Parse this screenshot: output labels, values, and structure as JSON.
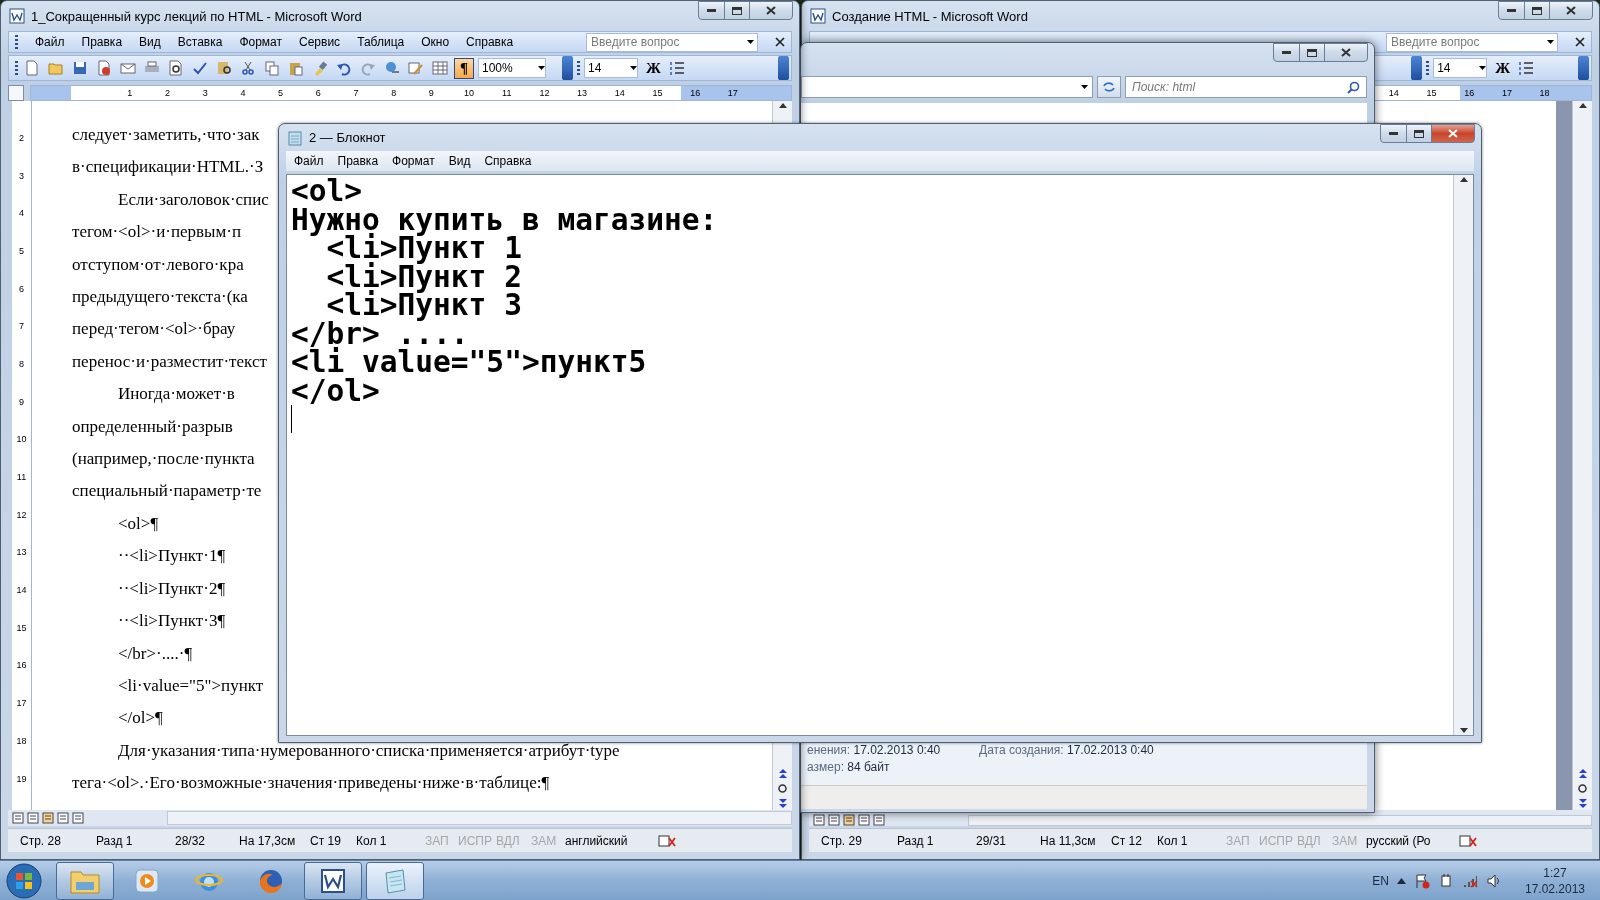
{
  "left_word": {
    "title": "1_Сокращенный курс лекций по HTML - Microsoft Word",
    "menu": [
      "Файл",
      "Правка",
      "Вид",
      "Вставка",
      "Формат",
      "Сервис",
      "Таблица",
      "Окно",
      "Справка"
    ],
    "question_placeholder": "Введите вопрос",
    "pilcrow_button": {
      "label": "¶",
      "selected": true
    },
    "zoom": "100%",
    "font_size": "14",
    "bold_button": "Ж",
    "ruler": [
      "1",
      "2",
      "3",
      "4",
      "5",
      "6",
      "7",
      "8",
      "9",
      "10",
      "11",
      "12",
      "13",
      "14",
      "15",
      "16",
      "17"
    ],
    "vertical_ruler": [
      "2",
      "3",
      "4",
      "5",
      "6",
      "7",
      "8",
      "9",
      "10",
      "11",
      "12",
      "13",
      "14",
      "15",
      "16",
      "17",
      "18",
      "19"
    ],
    "paragraphs": [
      {
        "kind": "plain",
        "text": "следует·заметить,·что·зак"
      },
      {
        "kind": "plain",
        "text": "в·спецификации·HTML.·З"
      },
      {
        "kind": "indent",
        "text": "Если·заголовок·спис"
      },
      {
        "kind": "plain",
        "text": "тегом·<ol>·и·первым·п"
      },
      {
        "kind": "plain",
        "text": "отступом·от·левого·кра"
      },
      {
        "kind": "plain",
        "text": "предыдущего·текста·(ка"
      },
      {
        "kind": "plain",
        "text": "перед·тегом·<ol>·брау"
      },
      {
        "kind": "plain",
        "text": "перенос·и·разместит·текст"
      },
      {
        "kind": "indent",
        "text": "Иногда·может·в"
      },
      {
        "kind": "plain",
        "text": "определенный·разрыв"
      },
      {
        "kind": "plain",
        "text": "(например,·после·пункта"
      },
      {
        "kind": "plain",
        "text": "специальный·параметр·те"
      },
      {
        "kind": "indent",
        "text": "<ol>¶"
      },
      {
        "kind": "indent",
        "text": "··<li>Пункт·1¶"
      },
      {
        "kind": "indent",
        "text": "··<li>Пункт·2¶"
      },
      {
        "kind": "indent",
        "text": "··<li>Пункт·3¶"
      },
      {
        "kind": "indent",
        "text": "</br>·....·¶"
      },
      {
        "kind": "indent",
        "text": "<li·value=\"5\">пункт"
      },
      {
        "kind": "indent",
        "text": "</ol>¶"
      },
      {
        "kind": "indent",
        "text": "Для·указания·типа·нумерованного·списка·применяется·атрибут·type"
      },
      {
        "kind": "plain",
        "text": "тега·<ol>.·Его·возможные·значения·приведены·ниже·в·таблице:¶"
      }
    ],
    "status": [
      {
        "text": "Стр. 28",
        "disabled": false
      },
      {
        "text": "Разд 1",
        "disabled": false
      },
      {
        "text": "28/32",
        "disabled": false
      },
      {
        "text": "На 17,3см",
        "disabled": false
      },
      {
        "text": "Ст 19",
        "disabled": false
      },
      {
        "text": "Кол 1",
        "disabled": false
      },
      {
        "text": "ЗАП",
        "disabled": true
      },
      {
        "text": "ИСПР",
        "disabled": true
      },
      {
        "text": "ВДЛ",
        "disabled": true
      },
      {
        "text": "ЗАМ",
        "disabled": true
      },
      {
        "text": "английский",
        "disabled": false
      }
    ]
  },
  "right_word": {
    "title": "Создание HTML - Microsoft Word",
    "question_placeholder": "Введите вопрос",
    "font_size": "14",
    "bold_button": "Ж",
    "ruler": [
      "14",
      "15",
      "16",
      "17",
      "18"
    ],
    "status": [
      {
        "text": "Стр. 29",
        "disabled": false
      },
      {
        "text": "Разд 1",
        "disabled": false
      },
      {
        "text": "29/31",
        "disabled": false
      },
      {
        "text": "На 11,3см",
        "disabled": false
      },
      {
        "text": "Ст 12",
        "disabled": false
      },
      {
        "text": "Кол 1",
        "disabled": false
      },
      {
        "text": "ЗАП",
        "disabled": true
      },
      {
        "text": "ИСПР",
        "disabled": true
      },
      {
        "text": "ВДЛ",
        "disabled": true
      },
      {
        "text": "ЗАМ",
        "disabled": true
      },
      {
        "text": "русский (Ро",
        "disabled": false
      }
    ]
  },
  "explorer": {
    "search_placeholder": "Поиск: html",
    "details": [
      {
        "label": "енения:",
        "value": "17.02.2013 0:40"
      },
      {
        "label": "Дата создания:",
        "value": "17.02.2013 0:40"
      },
      {
        "label": "азмер:",
        "value": "84 байт"
      }
    ]
  },
  "notepad": {
    "title": "2 — Блокнот",
    "menu": [
      "Файл",
      "Правка",
      "Формат",
      "Вид",
      "Справка"
    ],
    "lines": [
      "<ol>",
      "Нужно купить в магазине:",
      "  <li>Пункт 1",
      "  <li>Пункт 2",
      "  <li>Пункт 3",
      "</br> ....",
      "<li value=\"5\">пункт5",
      "</ol>"
    ]
  },
  "taskbar": {
    "apps": [
      {
        "kind": "folder",
        "running": true,
        "selected": false
      },
      {
        "kind": "media",
        "running": false,
        "selected": false
      },
      {
        "kind": "browser",
        "running": false,
        "selected": false
      },
      {
        "kind": "fox",
        "running": false,
        "selected": false
      },
      {
        "kind": "word",
        "running": true,
        "selected": false
      },
      {
        "kind": "notepad",
        "running": true,
        "selected": true
      }
    ],
    "language": "EN",
    "time": "1:27",
    "date": "17.02.2013"
  }
}
